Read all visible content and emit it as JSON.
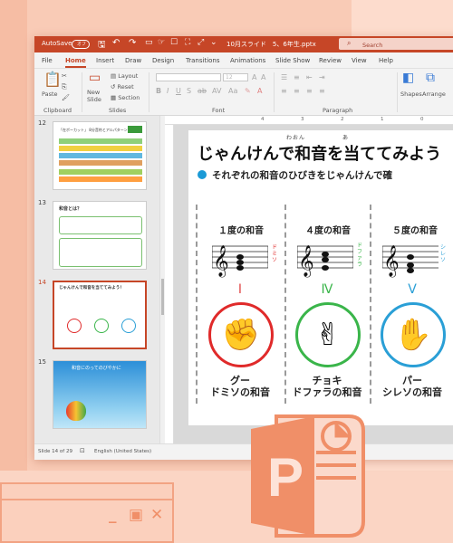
{
  "colors": {
    "accent": "#c64627",
    "logo": "#f08f68",
    "red": "#e02a2a",
    "green": "#3ab54a",
    "blue": "#2a9fd6"
  },
  "window": {
    "autosave": "AutoSave",
    "toggle": "オフ",
    "filename": "10月スライド　5、6年生.pptx",
    "search_placeholder": "Search",
    "tabs": [
      "File",
      "Home",
      "Insert",
      "Draw",
      "Design",
      "Transitions",
      "Animations",
      "Slide Show",
      "Review",
      "View",
      "Help"
    ],
    "active_tab": "Home",
    "ribbon": {
      "paste": "Paste",
      "new_slide": "New\nSlide",
      "layout": "Layout",
      "reset": "Reset",
      "section": "Section",
      "clipboard": "Clipboard",
      "slides": "Slides",
      "font": "Font",
      "paragraph": "Paragraph",
      "font_size": "12",
      "shapes": "Shapes",
      "arrange": "Arrange"
    }
  },
  "thumbnails": [
    {
      "num": "12",
      "title": "「在ボーカット」 8分音符とアルパターン"
    },
    {
      "num": "13",
      "title": "和音とは？"
    },
    {
      "num": "14",
      "title": "じゃんけんで和音を当ててみよう！"
    },
    {
      "num": "15",
      "title": "和音にのってのびやかに"
    }
  ],
  "ruler": [
    "4",
    "3",
    "2",
    "1",
    "0",
    "1"
  ],
  "slide": {
    "title": "じゃんけんで和音を当ててみよう",
    "furigana1": "わおん",
    "furigana2": "あ",
    "subtitle": "それぞれの和音のひびきをじゃんけんで確",
    "columns": [
      {
        "head": "１度の和音",
        "roman": "Ⅰ",
        "notes": "ドミソ",
        "hand": "✊",
        "caption1": "グー",
        "caption2": "ドミソの和音"
      },
      {
        "head": "４度の和音",
        "roman": "Ⅳ",
        "notes": "ドファラ",
        "hand": "✌",
        "caption1": "チョキ",
        "caption2": "ドファラの和音"
      },
      {
        "head": "５度の和音",
        "roman": "Ⅴ",
        "notes": "シレソ",
        "hand": "✋",
        "caption1": "パー",
        "caption2": "シレソの和音"
      }
    ]
  },
  "status": {
    "slide": "Slide 14 of 29",
    "language": "English (United States)"
  },
  "logo": {
    "letter": "P"
  }
}
